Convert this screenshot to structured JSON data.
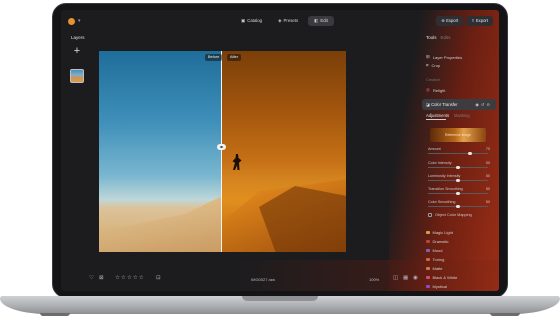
{
  "app": {
    "accent": "#e8912f"
  },
  "topbar": {
    "modes": [
      {
        "label": "Catalog",
        "icon": "catalog-icon",
        "active": false
      },
      {
        "label": "Presets",
        "icon": "presets-icon",
        "active": false
      },
      {
        "label": "Edit",
        "icon": "edit-icon",
        "active": true
      }
    ],
    "export_label": "Export",
    "share_label": "Export"
  },
  "layers": {
    "title": "Layers",
    "add_label": "+"
  },
  "image": {
    "before_label": "Before",
    "after_label": "After",
    "divider_handle": "◂▸"
  },
  "bottombar": {
    "filename": "IMG0027.raw",
    "zoom": "100%",
    "stars": "☆☆☆☆☆"
  },
  "panel": {
    "tools_tab": "Tools",
    "history_tab": "Edits",
    "layer_properties": "Layer Properties",
    "crop": "Crop",
    "section_creative": "Creative",
    "relight": "Relight",
    "active_tool": "Color Transfer",
    "sub_tab_adjustments": "Adjustments",
    "sub_tab_masking": "Masking",
    "reference_label": "Reference Image",
    "sliders": [
      {
        "label": "Amount",
        "value": "70",
        "fraction": 0.7
      },
      {
        "label": "Color Intensity",
        "value": "50",
        "fraction": 0.5
      },
      {
        "label": "Luminosity Intensity",
        "value": "50",
        "fraction": 0.5
      },
      {
        "label": "Transition Smoothing",
        "value": "50",
        "fraction": 0.5
      },
      {
        "label": "Color Smoothing",
        "value": "50",
        "fraction": 0.5
      }
    ],
    "checkbox_label": "Object Color Mapping",
    "categories": [
      {
        "label": "Magic Light",
        "color": "#c9a24a"
      },
      {
        "label": "Dramatic",
        "color": "#b5463a"
      },
      {
        "label": "Mood",
        "color": "#7a63b8"
      },
      {
        "label": "Toning",
        "color": "#d0693a"
      },
      {
        "label": "Matte",
        "color": "#c47a4a"
      },
      {
        "label": "Black & White",
        "color": "#d94a6a"
      },
      {
        "label": "Mystical",
        "color": "#8d4ac7"
      }
    ]
  }
}
